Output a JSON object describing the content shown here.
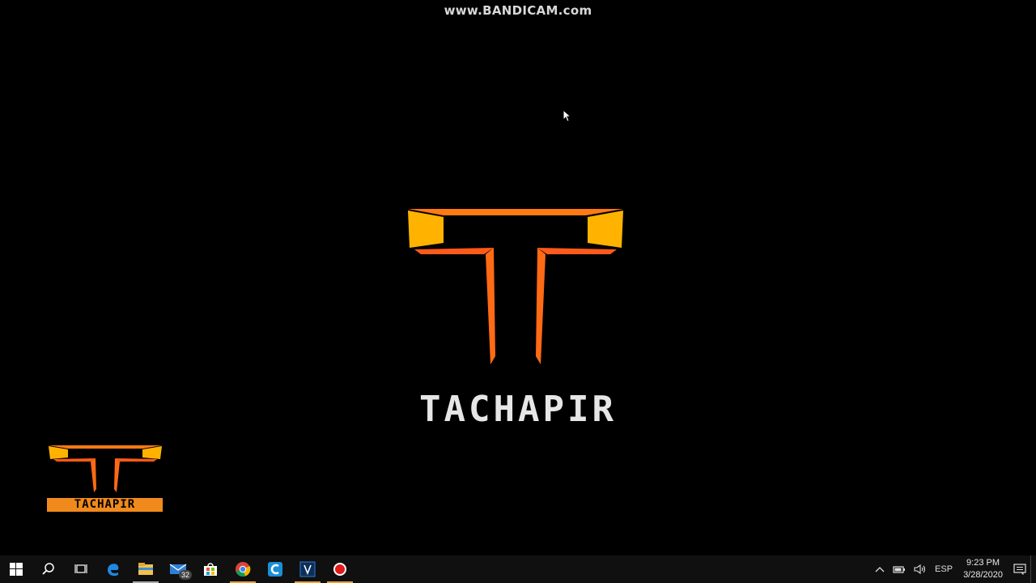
{
  "watermark": "www.BANDICAM.com",
  "desktop": {
    "brand": "TACHAPIR",
    "brand_small": "TACHAPIR",
    "logo_colors": {
      "orange": "#ff7a12",
      "yellow": "#ffb300",
      "red": "#ff5a1a"
    }
  },
  "taskbar": {
    "items": [
      {
        "name": "start-button",
        "icon": "windows-icon"
      },
      {
        "name": "search-button",
        "icon": "search-icon"
      },
      {
        "name": "task-view-button",
        "icon": "task-view-icon"
      },
      {
        "name": "edge-button",
        "icon": "edge-icon"
      },
      {
        "name": "file-explorer-button",
        "icon": "folder-icon"
      },
      {
        "name": "mail-button",
        "icon": "mail-icon",
        "badge": "32"
      },
      {
        "name": "store-button",
        "icon": "store-icon"
      },
      {
        "name": "chrome-button",
        "icon": "chrome-icon"
      },
      {
        "name": "ccleaner-button",
        "icon": "ccleaner-icon"
      },
      {
        "name": "vegas-button",
        "icon": "vegas-icon"
      },
      {
        "name": "bandicam-button",
        "icon": "record-icon"
      }
    ],
    "tray": {
      "language": "ESP",
      "time": "9:23 PM",
      "date": "3/28/2020"
    }
  }
}
